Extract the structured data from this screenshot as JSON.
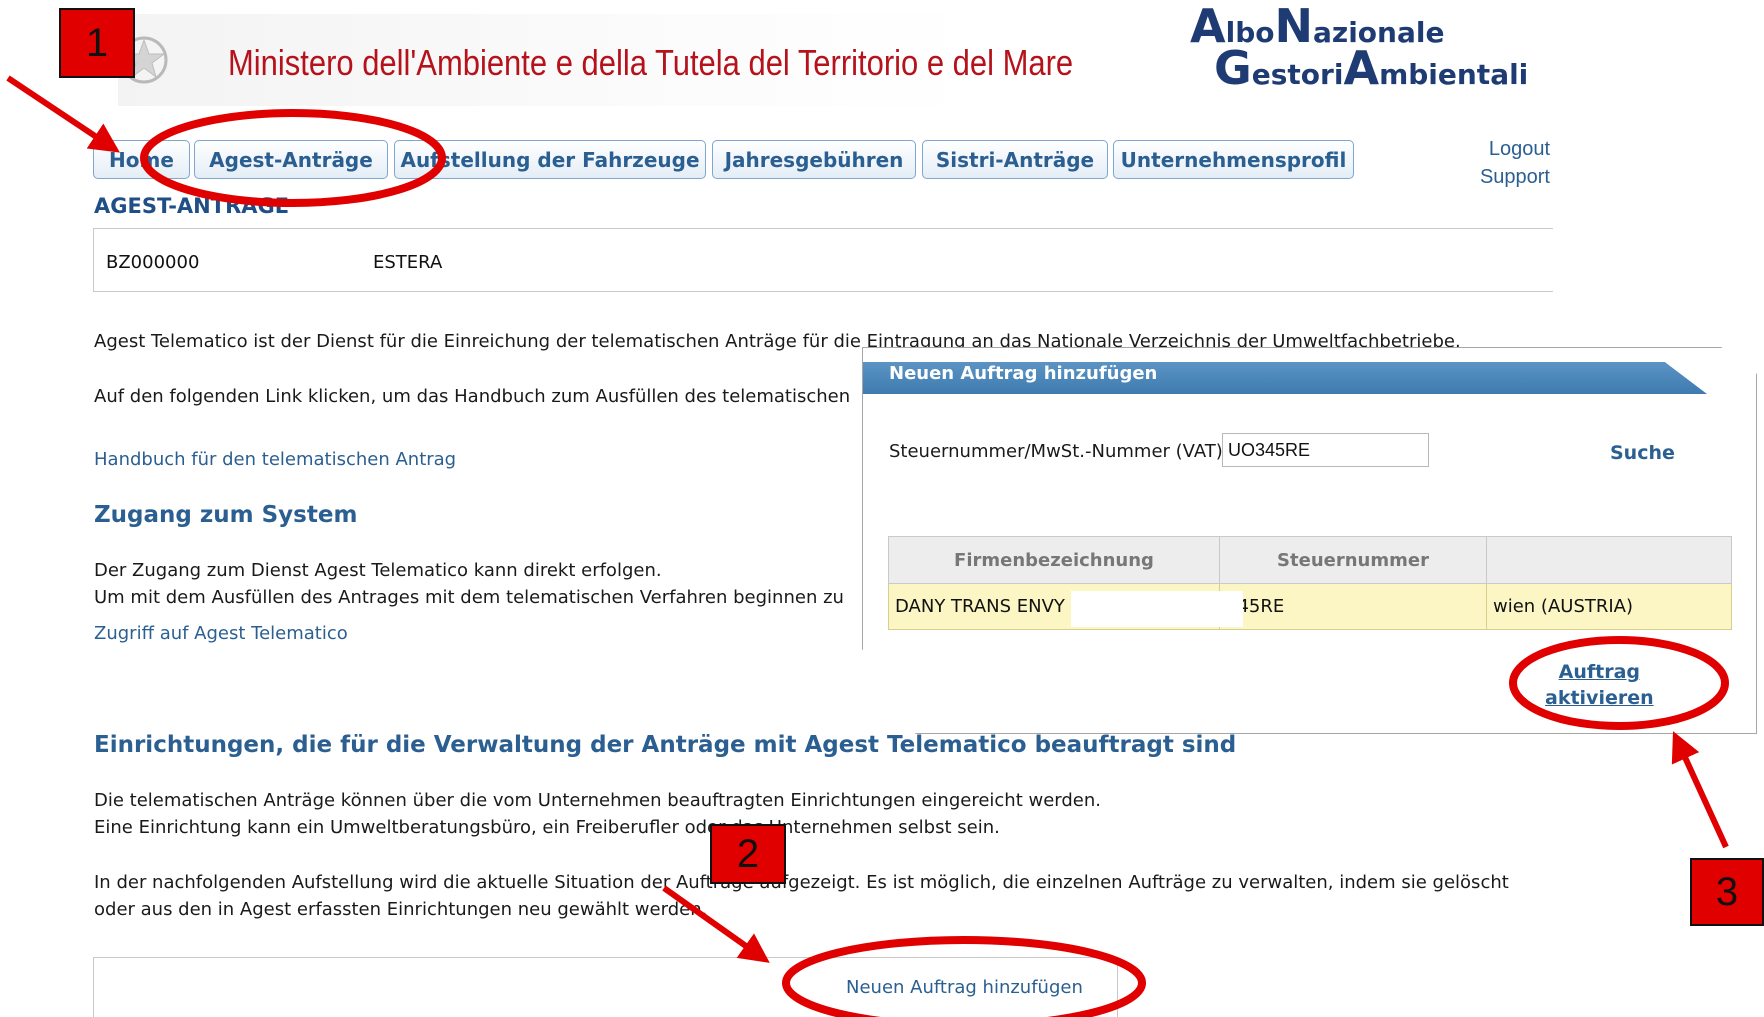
{
  "header": {
    "ministry_title": "Ministero dell'Ambiente e della Tutela del Territorio e del Mare",
    "logo": {
      "line1_cap1": "A",
      "line1_rest1": "lbo",
      "line1_cap2": "N",
      "line1_rest2": "azionale",
      "line2_cap1": "G",
      "line2_rest1": "estori",
      "line2_cap2": "A",
      "line2_rest2": "mbientali"
    }
  },
  "nav": {
    "tabs": [
      {
        "label": "Home"
      },
      {
        "label": "Agest-Anträge"
      },
      {
        "label": "Aufstellung der Fahrzeuge"
      },
      {
        "label": "Jahresgebühren"
      },
      {
        "label": "Sistri-Anträge"
      },
      {
        "label": "Unternehmensprofil"
      }
    ],
    "logout": "Logout",
    "support": "Support"
  },
  "page": {
    "section_title": "AGEST-ANTRAGE",
    "company_id": "BZ000000",
    "company_name": "ESTERA",
    "intro": "Agest Telematico ist der Dienst für die Einreichung der telematischen Anträge für die Eintragung an das Nationale Verzeichnis der Umweltfachbetriebe.",
    "manual_text": "Auf den folgenden Link klicken, um das Handbuch zum Ausfüllen des telematischen",
    "manual_link": "Handbuch für den telematischen Antrag",
    "access_heading": "Zugang zum System",
    "access_line1": "Der Zugang zum Dienst Agest Telematico kann direkt erfolgen.",
    "access_line2": "Um mit dem Ausfüllen des Antrages mit dem telematischen Verfahren beginnen zu",
    "access_link": "Zugriff auf Agest Telematico",
    "entities_heading": "Einrichtungen, die für die Verwaltung der Anträge mit Agest Telematico beauftragt sind",
    "entities_line1": "Die telematischen Anträge können über die vom Unternehmen beauftragten Einrichtungen eingereicht werden.",
    "entities_line2": "Eine Einrichtung kann ein Umweltberatungsbüro, ein Freiberufler oder das Unternehmen selbst sein.",
    "list_line1": "In der nachfolgenden Aufstellung wird die aktuelle Situation der Aufträge aufgezeigt. Es ist möglich, die einzelnen Aufträge zu verwalten, indem sie gelöscht",
    "list_line2": "oder aus den in Agest erfassten Einrichtungen neu gewählt werden.",
    "add_order_link": "Neuen Auftrag hinzufügen"
  },
  "popup": {
    "title": "Neuen Auftrag hinzufügen",
    "field_label": "Steuernummer/MwSt.-Nummer (VAT)",
    "field_value": "UO345RE",
    "search_label": "Suche",
    "columns": [
      "Firmenbezeichnung",
      "Steuernummer",
      ""
    ],
    "row": [
      "DANY TRANS ENVY",
      "345RE",
      "wien (AUSTRIA)"
    ],
    "activate_line1": "Auftrag",
    "activate_line2": "aktivieren"
  },
  "annotations": {
    "step1": "1",
    "step2": "2",
    "step3": "3",
    "color": "#e00000"
  }
}
